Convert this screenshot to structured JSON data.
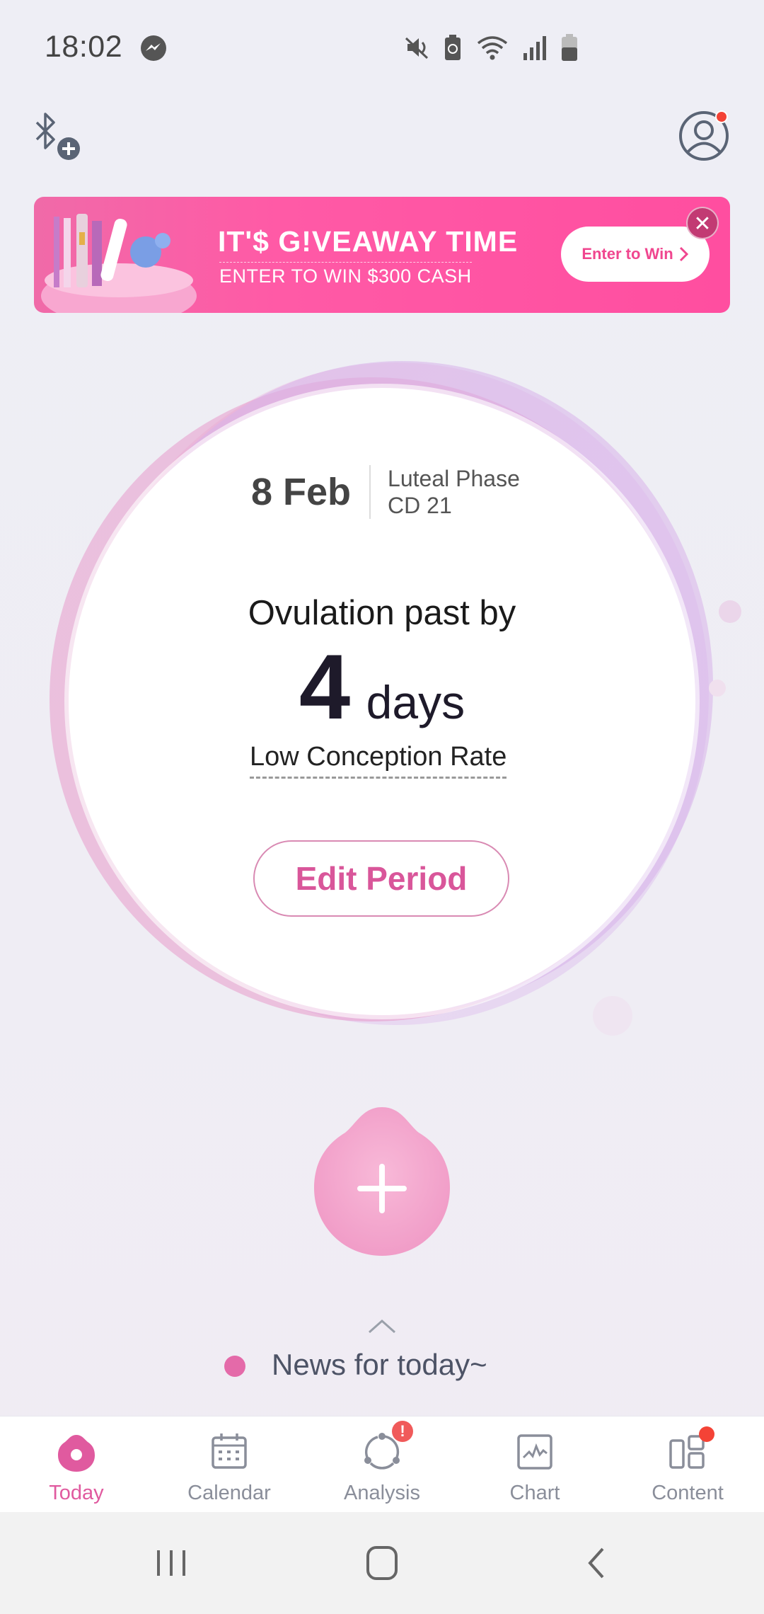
{
  "status_bar": {
    "time": "18:02",
    "icons": [
      "messenger-icon",
      "mute-icon",
      "battery-saver-icon",
      "wifi-icon",
      "signal-icon",
      "battery-icon"
    ]
  },
  "banner": {
    "title": "IT'$ G!VEAWAY TIME",
    "subtitle": "ENTER TO WIN $300 CASH",
    "cta_label": "Enter to Win",
    "close_label": "✕"
  },
  "cycle": {
    "date": "8 Feb",
    "phase": "Luteal Phase",
    "cycle_day": "CD 21",
    "ovulation_text": "Ovulation past by",
    "days_count": "4",
    "days_unit": "days",
    "conception_rate": "Low Conception Rate",
    "edit_button": "Edit Period"
  },
  "news": {
    "label": "News for today~"
  },
  "tabs": [
    {
      "label": "Today",
      "icon": "today-icon",
      "active": true
    },
    {
      "label": "Calendar",
      "icon": "calendar-icon",
      "active": false
    },
    {
      "label": "Analysis",
      "icon": "analysis-icon",
      "badge": "!"
    },
    {
      "label": "Chart",
      "icon": "chart-icon",
      "active": false
    },
    {
      "label": "Content",
      "icon": "content-icon",
      "dot": true
    }
  ],
  "colors": {
    "accent": "#e05a9f",
    "banner": "#ff4ea0",
    "badge": "#f05a5a"
  }
}
